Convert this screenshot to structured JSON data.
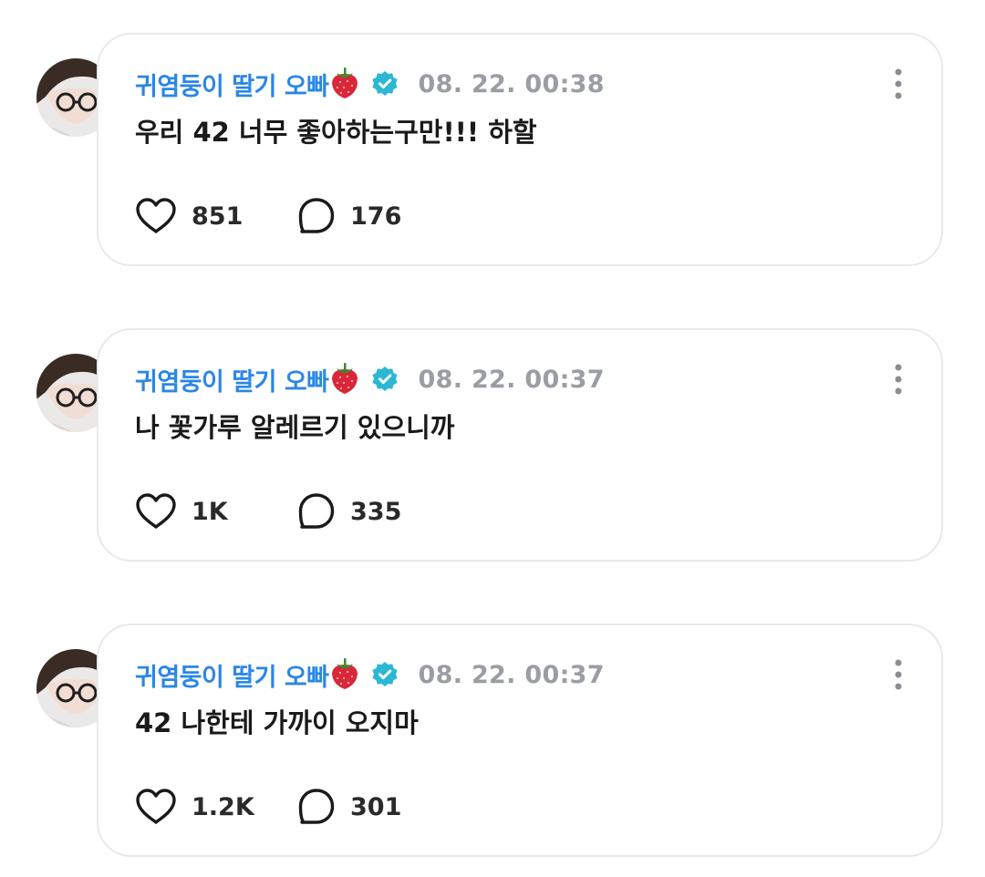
{
  "colors": {
    "username": "#2b86e6",
    "timestamp": "#9a9ea3",
    "verified_badge": "#2cb7d3",
    "card_border": "#e7e9ec",
    "text": "#1a1a1a"
  },
  "posts": [
    {
      "username": "귀염둥이 딸기 오빠",
      "username_emoji": "strawberry-icon",
      "verified": true,
      "timestamp": "08. 22. 00:38",
      "content": "우리 42 너무 좋아하는구만!!! 하할",
      "likes": "851",
      "comments": "176"
    },
    {
      "username": "귀염둥이 딸기 오빠",
      "username_emoji": "strawberry-icon",
      "verified": true,
      "timestamp": "08. 22. 00:37",
      "content": "나 꽃가루 알레르기 있으니까",
      "likes": "1K",
      "comments": "335"
    },
    {
      "username": "귀염둥이 딸기 오빠",
      "username_emoji": "strawberry-icon",
      "verified": true,
      "timestamp": "08. 22. 00:37",
      "content": "42 나한테 가까이 오지마",
      "likes": "1.2K",
      "comments": "301"
    }
  ]
}
